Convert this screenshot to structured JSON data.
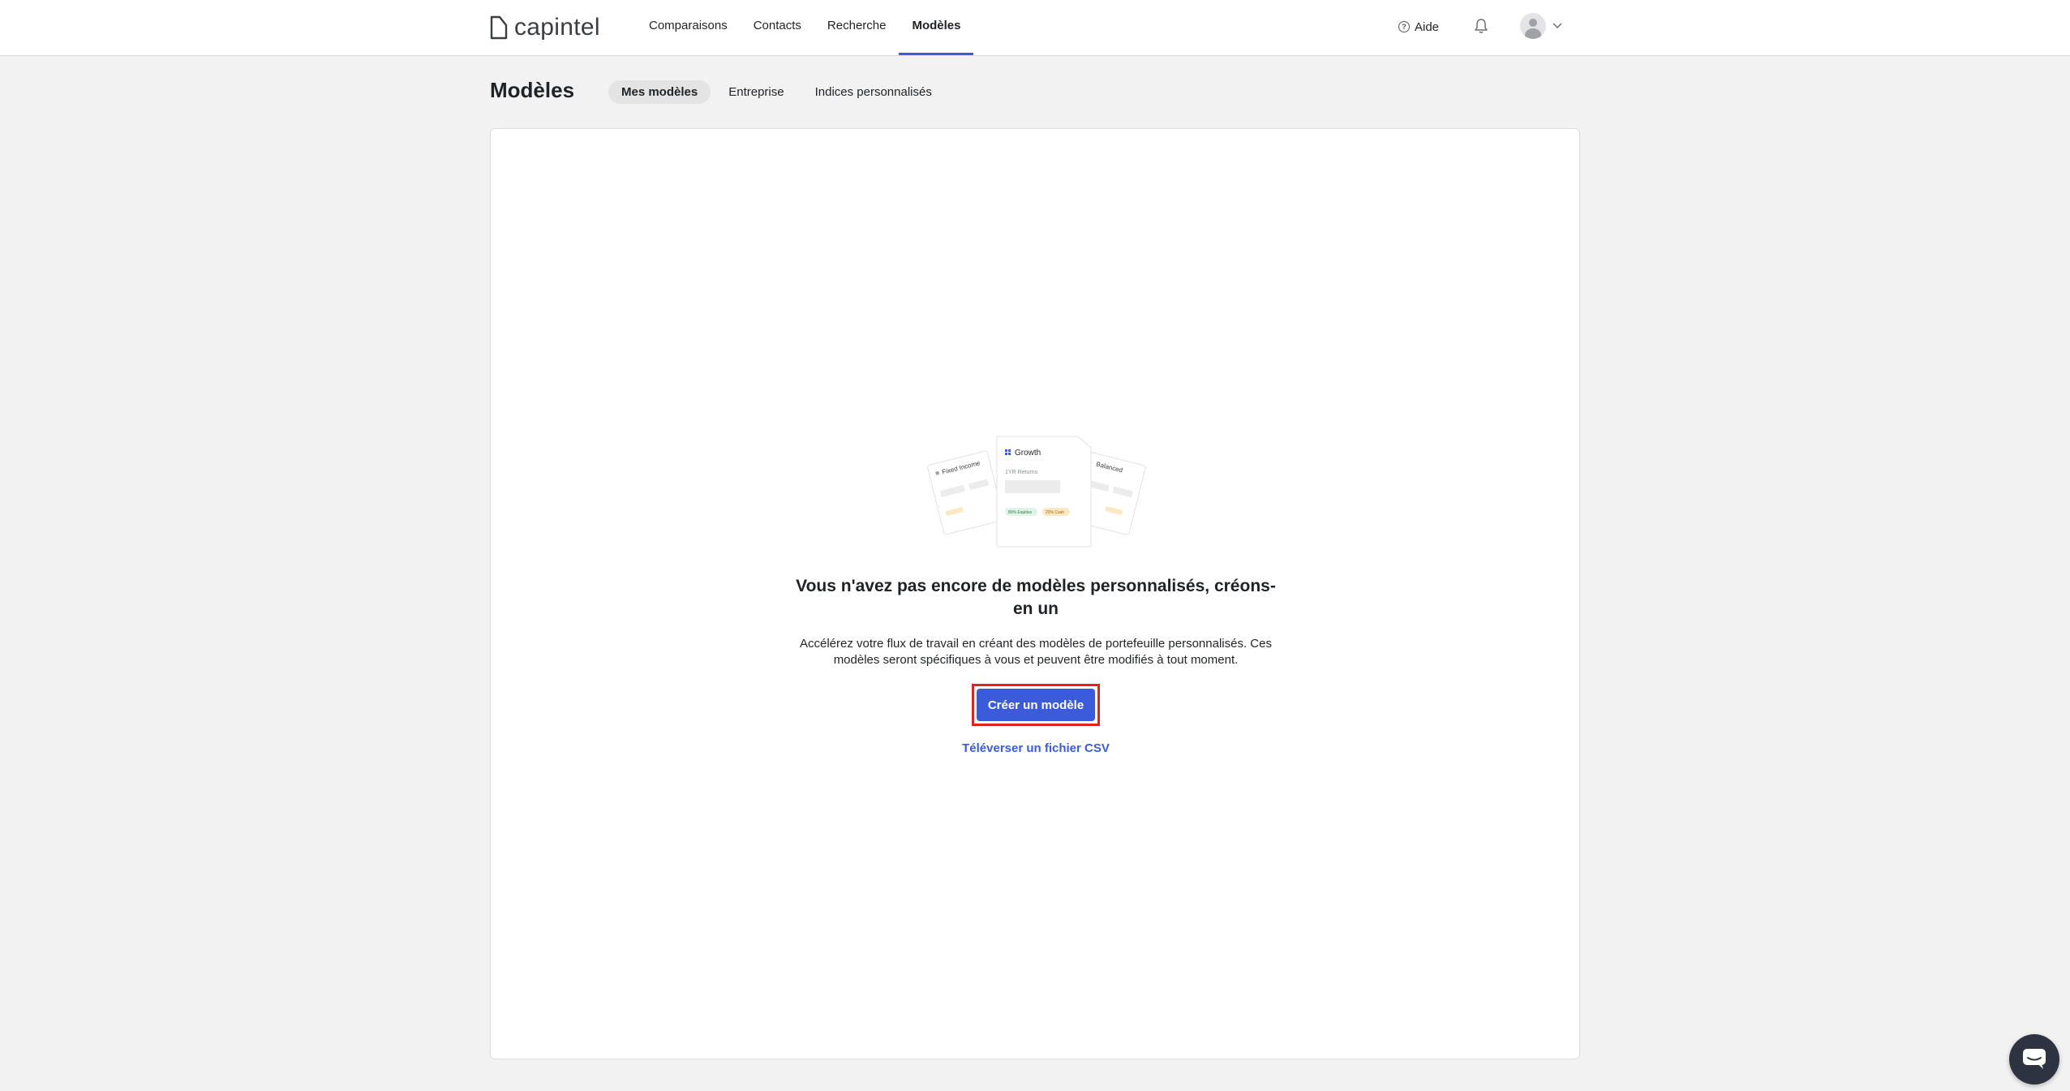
{
  "brand": {
    "name": "capintel"
  },
  "nav": {
    "items": [
      {
        "label": "Comparaisons",
        "active": false
      },
      {
        "label": "Contacts",
        "active": false
      },
      {
        "label": "Recherche",
        "active": false
      },
      {
        "label": "Modèles",
        "active": true
      }
    ],
    "help_label": "Aide",
    "accent_color": "#3b5bdb"
  },
  "page": {
    "title": "Modèles",
    "tabs": [
      {
        "label": "Mes modèles",
        "active": true
      },
      {
        "label": "Entreprise",
        "active": false
      },
      {
        "label": "Indices personnalisés",
        "active": false
      }
    ]
  },
  "empty_state": {
    "illustration": {
      "left_card_title": "Fixed Income",
      "center_card_title": "Growth",
      "center_card_subtitle": "1YR Returns",
      "center_tags": [
        "80% Equities",
        "20% Cash"
      ],
      "right_card_title": "Balanced"
    },
    "title": "Vous n'avez pas encore de modèles personnalisés, créons-en un",
    "description": "Accélérez votre flux de travail en créant des modèles de portefeuille personnalisés. Ces modèles seront spécifiques à vous et peuvent être modifiés à tout moment.",
    "primary_button": "Créer un modèle",
    "secondary_link": "Téléverser un fichier CSV"
  },
  "icons": [
    "logo-icon",
    "help-icon",
    "bell-icon",
    "avatar",
    "chevron-down-icon",
    "chat-icon"
  ]
}
